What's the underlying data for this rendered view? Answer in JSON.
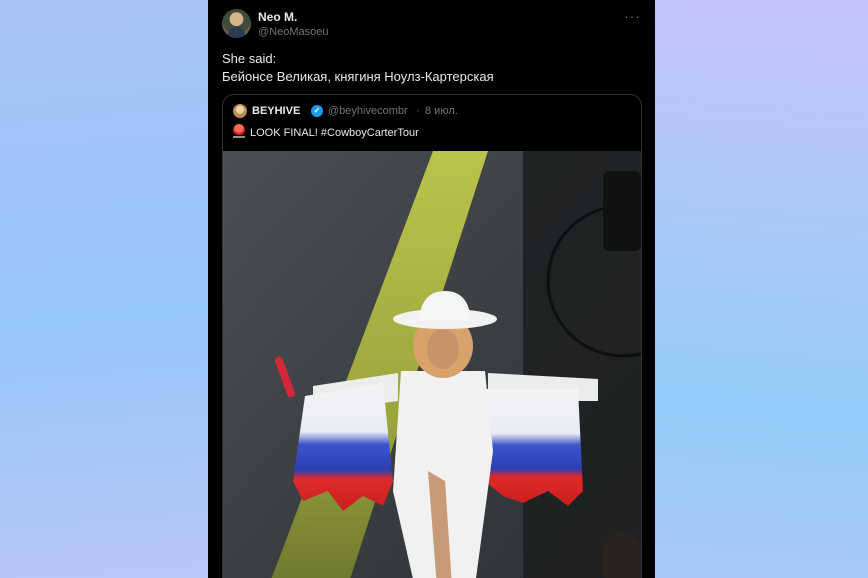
{
  "tweet": {
    "author_name": "Neo M.",
    "author_handle": "@NeoMasoeu",
    "more_icon": "more-horizontal-icon",
    "text_line1": "She said:",
    "text_line2": "Бейонсе Великая, княгиня Ноулз-Картерская"
  },
  "quoted_tweet": {
    "author_name": "BEYHIVE",
    "verified_icon": "verified-badge-icon",
    "author_handle": "@beyhivecombr",
    "separator": "·",
    "date": "8 июл.",
    "emoji_icon": "police-siren-icon",
    "text": "LOOK FINAL!  #CowboyCarterTour"
  },
  "colors": {
    "card_background": "#000000",
    "primary_text": "#e7e9ea",
    "secondary_text": "#71767b",
    "verified_blue": "#1d9bf0",
    "border": "#2f3336"
  }
}
